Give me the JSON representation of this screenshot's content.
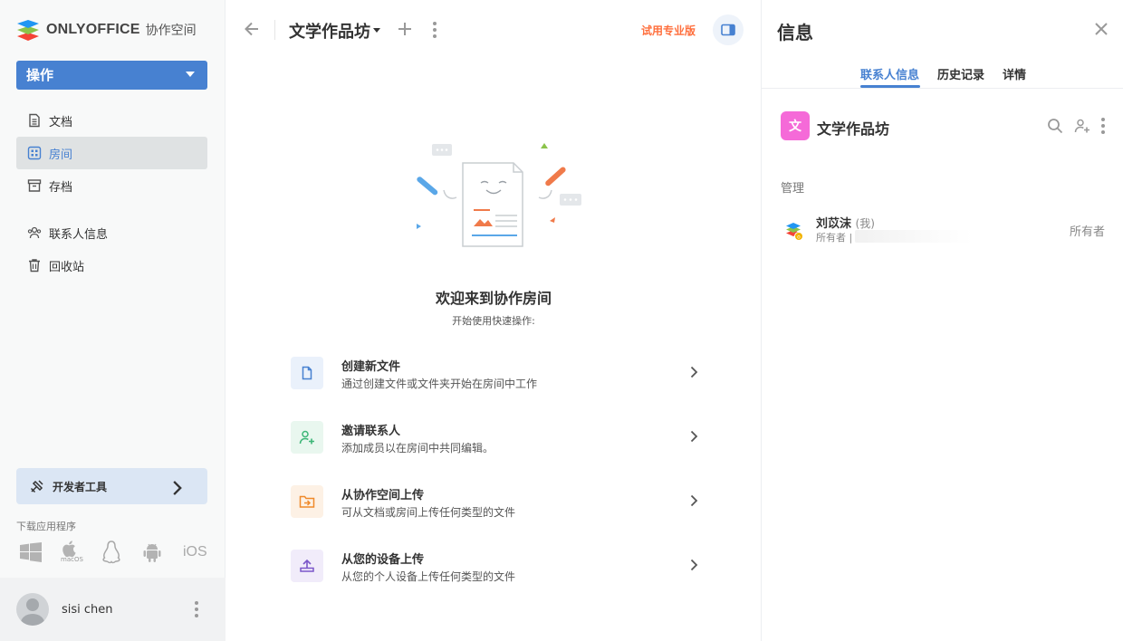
{
  "app": {
    "logo_text": "ONLYOFFICE",
    "logo_sub": "协作空间"
  },
  "sidebar": {
    "action_label": "操作",
    "items": [
      {
        "label": "文档",
        "icon": "document-icon"
      },
      {
        "label": "房间",
        "icon": "rooms-grid-icon",
        "active": true
      },
      {
        "label": "存档",
        "icon": "archive-icon"
      },
      {
        "label": "联系人信息",
        "icon": "contacts-icon"
      },
      {
        "label": "回收站",
        "icon": "trash-icon"
      }
    ],
    "devtools_label": "开发者工具",
    "download_title": "下载应用程序",
    "platforms": [
      "windows",
      "macOS",
      "linux",
      "android",
      "iOS"
    ],
    "user_name": "sisi chen"
  },
  "main": {
    "room_title": "文学作品坊",
    "trial_label": "试用专业版",
    "welcome_title": "欢迎来到协作房间",
    "welcome_sub": "开始使用快速操作:",
    "actions": [
      {
        "title": "创建新文件",
        "desc": "通过创建文件或文件夹开始在房间中工作",
        "color": "#4781d1",
        "bg": "#eaf1fb"
      },
      {
        "title": "邀请联系人",
        "desc": "添加成员以在房间中共同编辑。",
        "color": "#3db677",
        "bg": "#e9f7ef"
      },
      {
        "title": "从协作空间上传",
        "desc": "可从文档或房间上传任何类型的文件",
        "color": "#ef8a2b",
        "bg": "#fdf1e5"
      },
      {
        "title": "从您的设备上传",
        "desc": "从您的个人设备上传任何类型的文件",
        "color": "#7b57c9",
        "bg": "#f1ecfa"
      }
    ]
  },
  "info": {
    "title": "信息",
    "tabs": [
      "联系人信息",
      "历史记录",
      "详情"
    ],
    "room_badge": "文",
    "room_name": "文学作品坊",
    "group_label": "管理",
    "member": {
      "name": "刘苡沫",
      "me": "(我)",
      "sub": "所有者 |",
      "role": "所有者"
    }
  }
}
